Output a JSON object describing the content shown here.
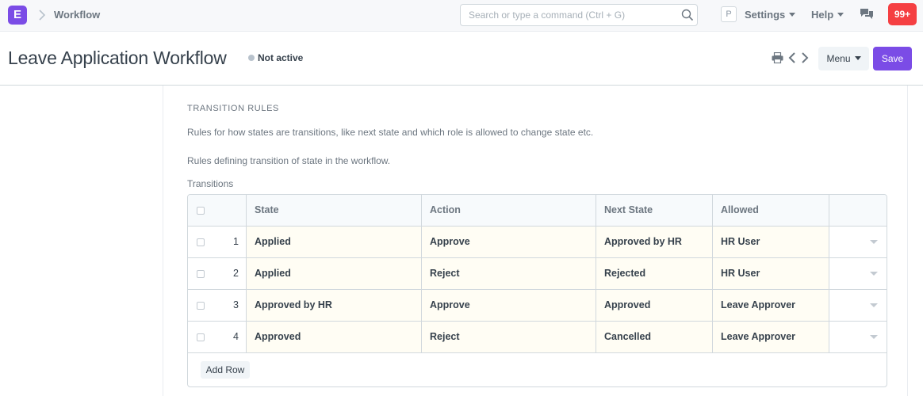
{
  "navbar": {
    "logo_letter": "E",
    "breadcrumb": "Workflow",
    "search_placeholder": "Search or type a command (Ctrl + G)",
    "avatar_letter": "P",
    "settings_label": "Settings",
    "help_label": "Help",
    "notification_count": "99+"
  },
  "page": {
    "title": "Leave Application Workflow",
    "status": "Not active",
    "menu_label": "Menu",
    "save_label": "Save"
  },
  "section": {
    "heading": "TRANSITION RULES",
    "description": "Rules for how states are transitions, like next state and which role is allowed to change state etc.",
    "field_description": "Rules defining transition of state in the workflow.",
    "field_label": "Transitions"
  },
  "grid": {
    "columns": [
      "State",
      "Action",
      "Next State",
      "Allowed"
    ],
    "rows": [
      {
        "idx": "1",
        "state": "Applied",
        "action": "Approve",
        "next_state": "Approved by HR",
        "allowed": "HR User"
      },
      {
        "idx": "2",
        "state": "Applied",
        "action": "Reject",
        "next_state": "Rejected",
        "allowed": "HR User"
      },
      {
        "idx": "3",
        "state": "Approved by HR",
        "action": "Approve",
        "next_state": "Approved",
        "allowed": "Leave Approver"
      },
      {
        "idx": "4",
        "state": "Approved",
        "action": "Reject",
        "next_state": "Cancelled",
        "allowed": "Leave Approver"
      }
    ],
    "add_row_label": "Add Row"
  },
  "colors": {
    "brand": "#7b4ce6",
    "notification": "#f53f42",
    "row_highlight": "#fffdf4"
  },
  "icons": [
    "logo-icon",
    "chevron-right-icon",
    "search-icon",
    "caret-down-icon",
    "chat-icon",
    "print-icon",
    "chevron-left-icon",
    "chevron-right-icon"
  ]
}
